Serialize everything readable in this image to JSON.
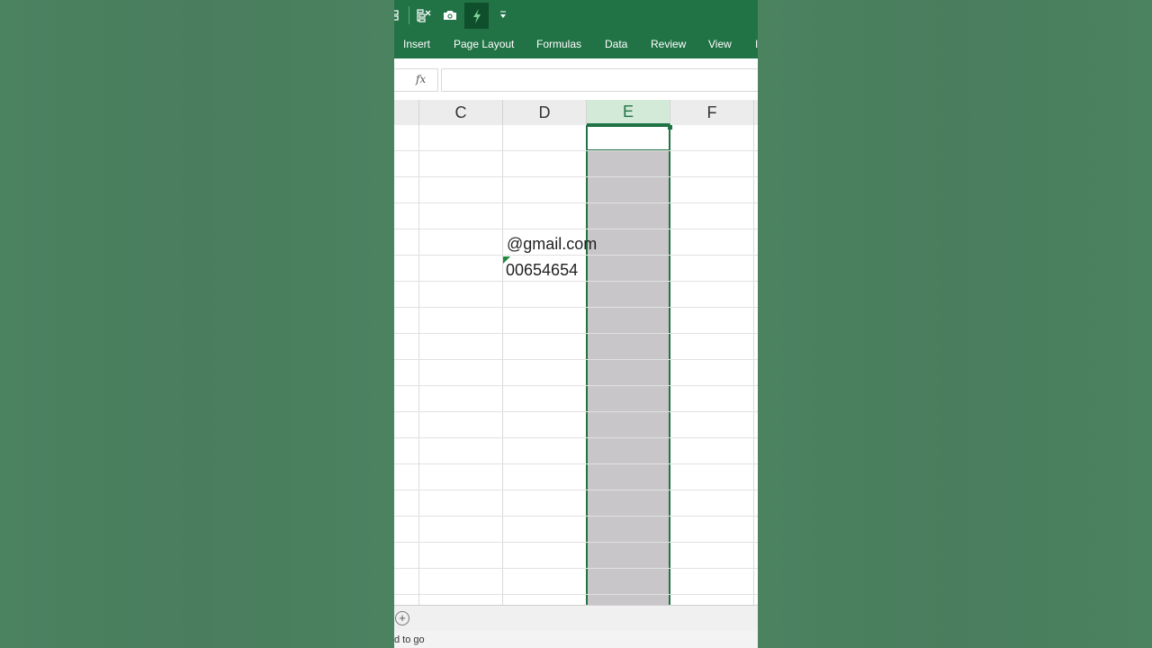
{
  "qat": {
    "icons": [
      "partial-icon",
      "remove-duplicates-icon",
      "camera-icon",
      "flash-fill-icon",
      "customize-qat-icon"
    ]
  },
  "ribbon": {
    "tabs": [
      "Insert",
      "Page Layout",
      "Formulas",
      "Data",
      "Review",
      "View",
      "I"
    ]
  },
  "formula_bar": {
    "fx_label": "fx",
    "value": ""
  },
  "columns": [
    "C",
    "D",
    "E",
    "F"
  ],
  "selected_column": "E",
  "cells": {
    "d4": "@gmail.com",
    "d5": "00654654"
  },
  "status": {
    "text": "d to go"
  },
  "colors": {
    "excel_green": "#217346",
    "selection_fill": "#c8c6c9"
  }
}
